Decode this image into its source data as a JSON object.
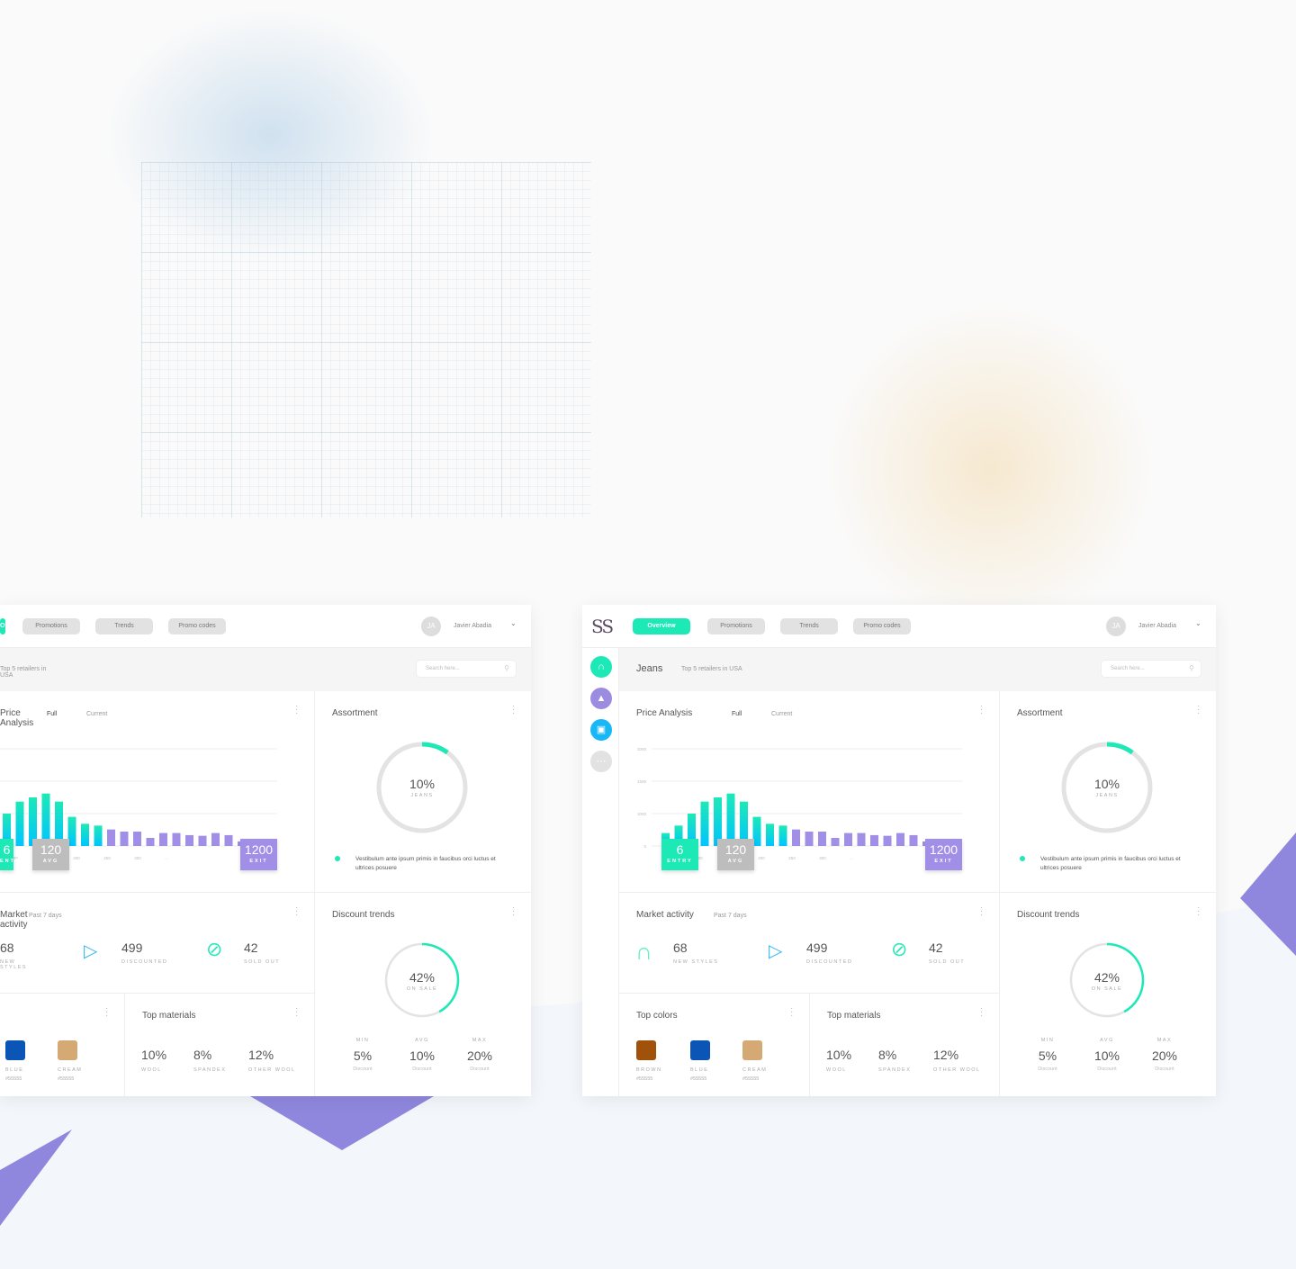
{
  "header": {
    "logo": "SS",
    "tabs": [
      {
        "label": "Overview",
        "active": true
      },
      {
        "label": "Promotions"
      },
      {
        "label": "Trends"
      },
      {
        "label": "Promo codes"
      }
    ],
    "avatar_initials": "JA",
    "user_name": "Javier Abadia",
    "chevron": "chevron-down-icon"
  },
  "sidebar": {
    "items": [
      {
        "icon": "jeans-icon",
        "color": "#1de9b6"
      },
      {
        "icon": "shoe-icon",
        "color": "#9c8ce0"
      },
      {
        "icon": "bag-icon",
        "color": "#18b7f5"
      },
      {
        "icon": "more-icon",
        "color": "#e2e2e2"
      }
    ]
  },
  "subheader": {
    "title": "Jeans",
    "subtitle": "Top 5 retailers in USA",
    "search_placeholder": "Search here..."
  },
  "price_analysis": {
    "title": "Price Analysis",
    "filter_full": "Full",
    "filter_current": "Current",
    "entry": {
      "value": "6",
      "label": "ENTRY",
      "color": "#1de9b6"
    },
    "avg": {
      "value": "120",
      "label": "AVG",
      "color": "#bdbdbd"
    },
    "exit": {
      "value": "1200",
      "label": "EXIT",
      "color": "#a18ee6"
    }
  },
  "assortment": {
    "title": "Assortment",
    "percent": 10,
    "value_text": "10%",
    "label": "JEANS",
    "legend": "Vestibulum ante ipsum primis in faucibus orci luctus et ultrices posuere",
    "accent": "#1de9b6"
  },
  "market_activity": {
    "title": "Market activity",
    "period": "Past 7 days",
    "stats": [
      {
        "icon": "jeans-icon",
        "value": "68",
        "label": "NEW STYLES"
      },
      {
        "icon": "price-tag-icon",
        "value": "499",
        "label": "DISCOUNTED"
      },
      {
        "icon": "sold-out-icon",
        "value": "42",
        "label": "SOLD OUT"
      }
    ]
  },
  "top_colors": {
    "title": "Top colors",
    "items": [
      {
        "name": "BROWN",
        "code": "#55555",
        "color": "#a0520a"
      },
      {
        "name": "BLUE",
        "code": "#55555",
        "color": "#0a55b5"
      },
      {
        "name": "CREAM",
        "code": "#55555",
        "color": "#d4a974"
      }
    ]
  },
  "top_materials": {
    "title": "Top materials",
    "items": [
      {
        "value": "10%",
        "label": "WOOL"
      },
      {
        "value": "8%",
        "label": "SPANDEX"
      },
      {
        "value": "12%",
        "label": "OTHER WOOL"
      }
    ]
  },
  "discount_trends": {
    "title": "Discount trends",
    "percent": 42,
    "value_text": "42%",
    "label": "ON SALE",
    "stats": [
      {
        "label": "MIN",
        "value": "5%",
        "sub": "Discount"
      },
      {
        "label": "AVG",
        "value": "10%",
        "sub": "Discount"
      },
      {
        "label": "MAX",
        "value": "20%",
        "sub": "Discount"
      }
    ]
  },
  "chart_data": {
    "type": "bar",
    "title": "Price Analysis",
    "y_ticks": [
      0,
      1000,
      1500,
      2000
    ],
    "x_ticks": [
      "50",
      "100",
      "150",
      "200",
      "250",
      "300",
      "..."
    ],
    "values": [
      400,
      630,
      1000,
      1185,
      1250,
      1310,
      1185,
      900,
      685,
      630,
      510,
      445,
      445,
      250,
      400,
      400,
      335,
      315,
      400,
      335,
      140,
      110
    ],
    "colors": {
      "low": "#00c4ff",
      "high": "#1de9b6",
      "tail": "#a18ee6"
    },
    "grid": true
  }
}
